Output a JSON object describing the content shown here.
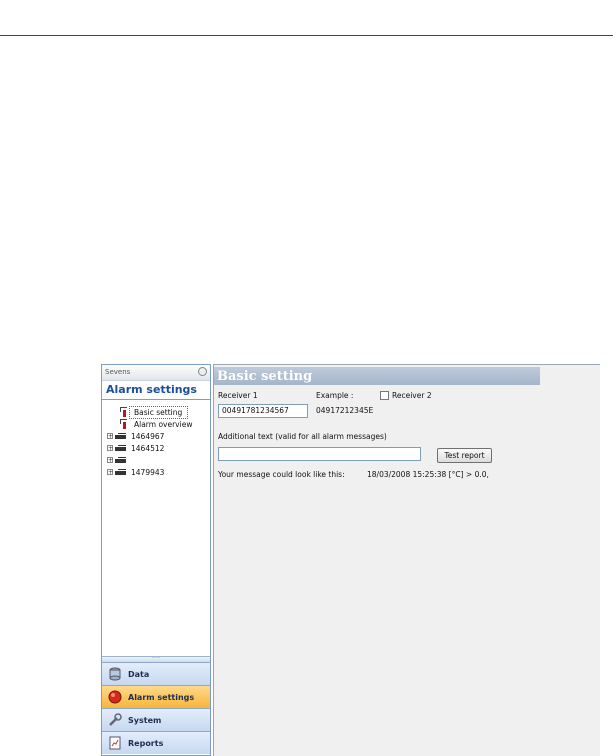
{
  "sidebar": {
    "header": "Sevens",
    "title": "Alarm settings",
    "tree": [
      {
        "label": "Basic setting"
      },
      {
        "label": "Alarm overview"
      },
      {
        "label": "1464967"
      },
      {
        "label": "1464512"
      },
      {
        "label": ""
      },
      {
        "label": "1479943"
      }
    ],
    "nav": [
      {
        "label": "Data"
      },
      {
        "label": "Alarm settings"
      },
      {
        "label": "System"
      },
      {
        "label": "Reports"
      }
    ]
  },
  "content": {
    "title": "Basic setting",
    "receiver1_label": "Receiver 1",
    "receiver1_value": "00491781234567",
    "example_label": "Example :",
    "example_value": "04917212345E",
    "receiver2_label": "Receiver 2",
    "receiver2_checked": false,
    "additional_label": "Additional text (valid for all alarm messages)",
    "additional_value": "",
    "test_button": "Test report",
    "message_label": "Your message could look like this:",
    "message_value": "18/03/2008 15:25:38 [°C] > 0.0,"
  },
  "colors": {
    "accent": "#1a4f9c",
    "active_nav": "#f8b53a",
    "header_band": "#a4b5cb"
  }
}
